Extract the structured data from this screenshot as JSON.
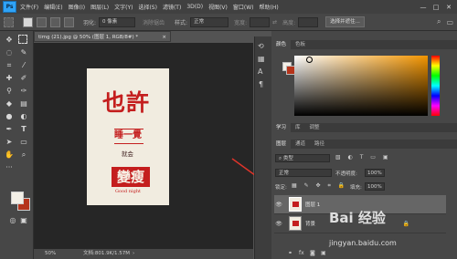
{
  "app": {
    "logo": "Ps"
  },
  "menu": [
    "文件(F)",
    "编辑(E)",
    "图像(I)",
    "图层(L)",
    "文字(Y)",
    "选择(S)",
    "滤镜(T)",
    "3D(D)",
    "视图(V)",
    "窗口(W)",
    "帮助(H)"
  ],
  "window_controls": [
    "—",
    "□",
    "✕"
  ],
  "options": {
    "feather_label": "羽化:",
    "feather_value": "0 像素",
    "antialias_label": "消除锯齿",
    "style_label": "样式:",
    "style_value": "正常",
    "width_label": "宽度:",
    "height_label": "高度:",
    "select_mask_button": "选择并遮住..."
  },
  "document": {
    "tab_title": "timg (21).jpg @ 50% (图层 1, RGB/8#) *",
    "close_glyph": "×",
    "zoom": "50%",
    "doc_info": "文档:801.9K/1.57M",
    "artwork": {
      "line1": "也許",
      "line2": "睡一覺",
      "line3": "就会",
      "line4": "變瘦",
      "line5": "Good night"
    }
  },
  "color_panel": {
    "tabs": [
      "颜色",
      "色板"
    ]
  },
  "lower_panel": {
    "tabs": [
      "学习",
      "库",
      "调整"
    ]
  },
  "layers_panel": {
    "tabs": [
      "图层",
      "通道",
      "路径"
    ],
    "kind_label": "类型",
    "blend_mode": "正常",
    "opacity_label": "不透明度:",
    "opacity_value": "100%",
    "lock_label": "锁定:",
    "fill_label": "填充:",
    "fill_value": "100%",
    "layers": [
      {
        "name": "图层 1",
        "selected": true
      },
      {
        "name": "背景",
        "selected": false
      }
    ]
  },
  "watermark": {
    "text": "Bai 经验",
    "url": "jingyan.baidu.com"
  },
  "colors": {
    "accent_red": "#c41e1e",
    "foreground_swatch": "#f3efe6",
    "background_swatch": "#b5341b",
    "arrow": "#e0342a"
  }
}
